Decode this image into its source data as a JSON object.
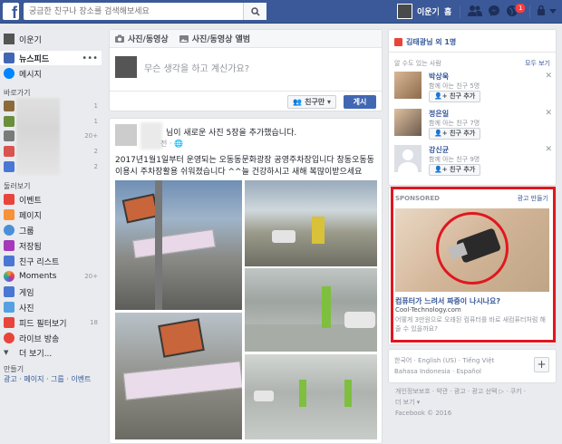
{
  "topbar": {
    "search_placeholder": "궁금한 친구나 장소를 검색해보세요",
    "user_name": "이운기",
    "home": "홈",
    "notification_count": "1"
  },
  "leftnav": {
    "profile": "이운기",
    "news_feed": "뉴스피드",
    "messages": "메시지",
    "shortcuts_head": "바로가기",
    "shortcut_counts": [
      "1",
      "1",
      "20+",
      "2",
      "2"
    ],
    "explore_head": "둘러보기",
    "explore": [
      {
        "label": "이벤트",
        "count": "",
        "color": "#e9443b"
      },
      {
        "label": "페이지",
        "count": "",
        "color": "#f7923a"
      },
      {
        "label": "그룹",
        "count": "",
        "color": "#4a90d9"
      },
      {
        "label": "저장됨",
        "count": "",
        "color": "#a53ab9"
      },
      {
        "label": "친구 리스트",
        "count": "",
        "color": "#4a77d4"
      },
      {
        "label": "Moments",
        "count": "20+",
        "color": "#2bb673"
      },
      {
        "label": "게임",
        "count": "",
        "color": "#4a77d4"
      },
      {
        "label": "사진",
        "count": "",
        "color": "#55a0e0"
      },
      {
        "label": "피드 필터보기",
        "count": "18",
        "color": "#e9443b"
      },
      {
        "label": "라이브 방송",
        "count": "",
        "color": "#e9443b"
      }
    ],
    "more": "더 보기...",
    "create_head": "만들기",
    "create_links": "광고 · 페이지 · 그룹 · 이벤트"
  },
  "composer": {
    "tab_photo": "사진/동영상",
    "tab_album": "사진/동영상 앨범",
    "prompt": "무슨 생각을 하고 계신가요?",
    "audience": "친구만",
    "post": "게시"
  },
  "post": {
    "header": "님이 새로운 사진 5장을 추가했습니다.",
    "meta": "전 · 🌐",
    "text": "2017년1월1일부터 운영되는 오동동문화광장 공영주차장입니다 창동오동동 이용시 주차장활용 쉬워졌습니다 ^^늘 건강하시고 새해 복많이받으세요"
  },
  "right": {
    "birthday": "김태광님 외 1명",
    "suggest_head": "알 수도 있는 사람",
    "see_all": "모두 보기",
    "suggestions": [
      {
        "name": "박상욱",
        "mutual": "함께 아는 친구 5명",
        "button": "친구 추가"
      },
      {
        "name": "정은일",
        "mutual": "함께 아는 친구 7명",
        "button": "친구 추가"
      },
      {
        "name": "강신균",
        "mutual": "함께 아는 친구 9명",
        "button": "친구 추가"
      }
    ],
    "sponsored": "SPONSORED",
    "create_ad": "광고 만들기",
    "ad_title": "컴퓨터가 느려서 짜증이 나시나요?",
    "ad_domain": "Cool-Technology.com",
    "ad_desc": "어떻게 3만원으로 오래된 컴퓨터를 바로 새컴퓨터처럼 해줄 수 있을까요?",
    "languages_line1": "한국어 · English (US) · Tiếng Việt",
    "languages_line2": "Bahasa Indonesia · Español",
    "add": "+",
    "footer_line1": "개인정보보호 · 약관 · 광고 · 광고 선택 ▷ · 쿠키 ·",
    "footer_line2": "더 보기 ▾",
    "footer_copy": "Facebook © 2016"
  }
}
